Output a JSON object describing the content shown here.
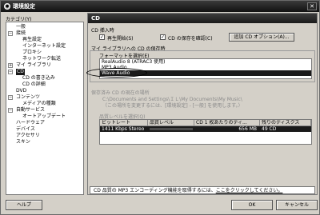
{
  "window": {
    "title": "環境設定",
    "close_glyph": "✕",
    "app_icon_glyph": "●"
  },
  "sidebar": {
    "label": "カテゴリ(Y)",
    "items": [
      {
        "label": "一般",
        "selected": false
      },
      {
        "label": "接続",
        "selected": false,
        "expanded": true
      },
      {
        "label": "再生設定",
        "selected": false
      },
      {
        "label": "インターネット設定",
        "selected": false
      },
      {
        "label": "プロキシ",
        "selected": false
      },
      {
        "label": "ネットワーク転送",
        "selected": false
      },
      {
        "label": "マイ ライブラリ",
        "selected": false,
        "expanded": false
      },
      {
        "label": "CD",
        "selected": true,
        "expanded": true
      },
      {
        "label": "CD の書き込み",
        "selected": false
      },
      {
        "label": "CD の詳細",
        "selected": false
      },
      {
        "label": "DVD",
        "selected": false
      },
      {
        "label": "コンテンツ",
        "selected": false,
        "expanded": true
      },
      {
        "label": "メディアの種類",
        "selected": false
      },
      {
        "label": "自動サービス",
        "selected": false,
        "expanded": true
      },
      {
        "label": "オートアップデート",
        "selected": false
      },
      {
        "label": "ハードウェア",
        "selected": false
      },
      {
        "label": "デバイス",
        "selected": false
      },
      {
        "label": "アクセサリ",
        "selected": false
      },
      {
        "label": "スキン",
        "selected": false
      }
    ]
  },
  "panel": {
    "header": "CD",
    "insert_section": "CD 挿入時",
    "play_start": {
      "label": "再生開始(S)",
      "checked": true
    },
    "confirm_save": {
      "label": "CD の保存を確認(C)",
      "checked": true
    },
    "add_cd_option_button": "追加 CD オプション(A)...",
    "library_group": "マイ ライブラリへの CD の保存時",
    "format_label": "フォーマットを選択(E)",
    "formats": [
      {
        "label": "RealAudio 8 (ATRAC3 使用)",
        "selected": false
      },
      {
        "label": "MP3 Audio",
        "selected": false
      },
      {
        "label": "Wave Audio",
        "selected": true
      }
    ],
    "save_location_label": "保存済み CD の現在の場所",
    "save_location_path": "C:\\Documents and Settings\\ＩＬ\\My Documents\\My Music\\",
    "save_location_note": "（この場所を変更するには、[環境設定] - [一般] を使用します。）",
    "quality_label": "品質レベルを選択(Q)",
    "quality_table": {
      "columns": [
        "ビットレート",
        "品質レベル",
        "CD 1 枚あたりのディ...",
        "残りのディスクス"
      ],
      "rows": [
        {
          "bitrate": "1411 Kbps Stereo",
          "quality_fraction": 1.0,
          "per_cd": "656 MB",
          "remaining": "49 CD"
        }
      ]
    },
    "info_text": "CD 品質の MP3 エンコーディング機能を取得するには、",
    "info_link": "ここをクリックしてください。"
  },
  "buttons": {
    "help": "ヘルプ",
    "ok": "OK",
    "cancel": "キャンセル"
  }
}
